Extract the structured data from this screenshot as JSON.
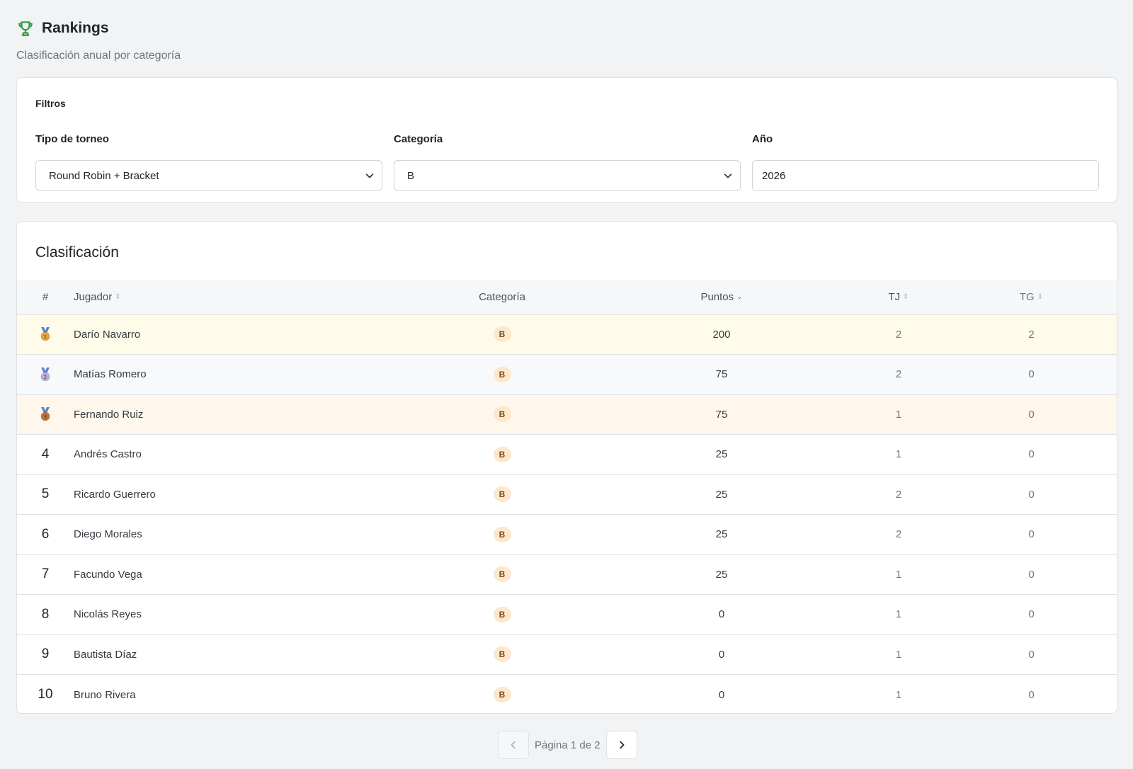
{
  "header": {
    "title": "Rankings",
    "subtitle": "Clasificación anual por categoría"
  },
  "filters": {
    "title": "Filtros",
    "tournament_type": {
      "label": "Tipo de torneo",
      "value": "Round Robin + Bracket"
    },
    "category": {
      "label": "Categoría",
      "value": "B"
    },
    "year": {
      "label": "Año",
      "value": "2026"
    }
  },
  "ranking": {
    "title": "Clasificación",
    "columns": {
      "rank": "#",
      "player": "Jugador",
      "category": "Categoría",
      "points": "Puntos",
      "tj": "TJ",
      "tg": "TG"
    },
    "rows": [
      {
        "rank": "1",
        "player": "Darío Navarro",
        "category": "B",
        "points": "200",
        "tj": "2",
        "tg": "2"
      },
      {
        "rank": "2",
        "player": "Matías Romero",
        "category": "B",
        "points": "75",
        "tj": "2",
        "tg": "0"
      },
      {
        "rank": "3",
        "player": "Fernando Ruiz",
        "category": "B",
        "points": "75",
        "tj": "1",
        "tg": "0"
      },
      {
        "rank": "4",
        "player": "Andrés Castro",
        "category": "B",
        "points": "25",
        "tj": "1",
        "tg": "0"
      },
      {
        "rank": "5",
        "player": "Ricardo Guerrero",
        "category": "B",
        "points": "25",
        "tj": "2",
        "tg": "0"
      },
      {
        "rank": "6",
        "player": "Diego Morales",
        "category": "B",
        "points": "25",
        "tj": "2",
        "tg": "0"
      },
      {
        "rank": "7",
        "player": "Facundo Vega",
        "category": "B",
        "points": "25",
        "tj": "1",
        "tg": "0"
      },
      {
        "rank": "8",
        "player": "Nicolás Reyes",
        "category": "B",
        "points": "0",
        "tj": "1",
        "tg": "0"
      },
      {
        "rank": "9",
        "player": "Bautista Díaz",
        "category": "B",
        "points": "0",
        "tj": "1",
        "tg": "0"
      },
      {
        "rank": "10",
        "player": "Bruno Rivera",
        "category": "B",
        "points": "0",
        "tj": "1",
        "tg": "0"
      }
    ],
    "medal_colors": [
      "#e8a33d",
      "#b7b2d6",
      "#b8733f"
    ],
    "row_highlights": [
      "#fffbe9",
      "#f7f9fb",
      "#fff6ec"
    ]
  },
  "pagination": {
    "label": "Página 1 de 2",
    "prev_icon": "chevron-left-icon",
    "next_icon": "chevron-right-icon"
  },
  "colors": {
    "brand_green": "#2f9e44",
    "badge_bg": "#fde8cf"
  }
}
